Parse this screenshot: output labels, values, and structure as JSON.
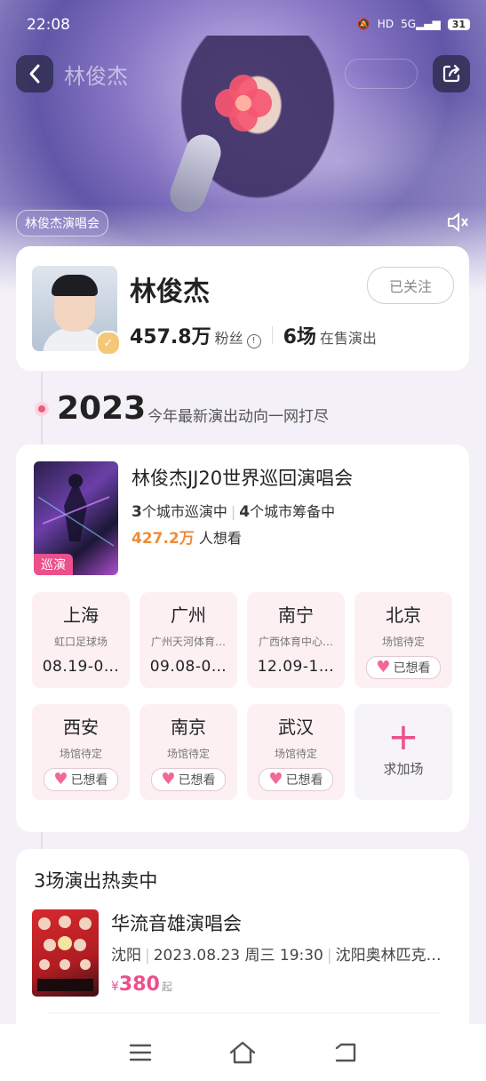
{
  "status_bar": {
    "time": "22:08",
    "battery": "31"
  },
  "header": {
    "title": "林俊杰",
    "hero_tag": "林俊杰演唱会"
  },
  "artist": {
    "name": "林俊杰",
    "follow_label": "已关注",
    "fans_value": "457.8万",
    "fans_label": "粉丝",
    "shows_value": "6场",
    "shows_label": "在售演出"
  },
  "timeline": {
    "year": "2023",
    "subtitle": "今年最新演出动向一网打尽"
  },
  "tour": {
    "poster_tag": "巡演",
    "title": "林俊杰JJ20世界巡回演唱会",
    "touring_count": "3",
    "touring_label": "个城市巡演中",
    "prep_count": "4",
    "prep_label": "个城市筹备中",
    "want_count": "427.2万",
    "want_label": "人想看",
    "cities": [
      {
        "name": "上海",
        "venue": "虹口足球场",
        "date": "08.19-0…"
      },
      {
        "name": "广州",
        "venue": "广州天河体育…",
        "date": "09.08-0…"
      },
      {
        "name": "南宁",
        "venue": "广西体育中心…",
        "date": "12.09-1…"
      },
      {
        "name": "北京",
        "venue": "场馆待定",
        "want": "已想看"
      },
      {
        "name": "西安",
        "venue": "场馆待定",
        "want": "已想看"
      },
      {
        "name": "南京",
        "venue": "场馆待定",
        "want": "已想看"
      },
      {
        "name": "武汉",
        "venue": "场馆待定",
        "want": "已想看"
      }
    ],
    "add_city_label": "求加场"
  },
  "selling": {
    "title": "3场演出热卖中",
    "show": {
      "name": "华流音雄演唱会",
      "city": "沈阳",
      "datetime": "2023.08.23 周三 19:30",
      "venue": "沈阳奥林匹克…",
      "currency": "¥",
      "price": "380",
      "price_suffix": "起"
    }
  },
  "colors": {
    "accent": "#ec4f8c",
    "want_orange": "#ef8c3a",
    "card_pink": "#fdf0f2"
  },
  "icons": [
    "back-arrow-icon",
    "share-icon",
    "mute-icon",
    "verified-badge-icon",
    "info-icon",
    "heart-icon",
    "plus-icon",
    "menu-icon",
    "home-icon",
    "back-nav-icon"
  ]
}
